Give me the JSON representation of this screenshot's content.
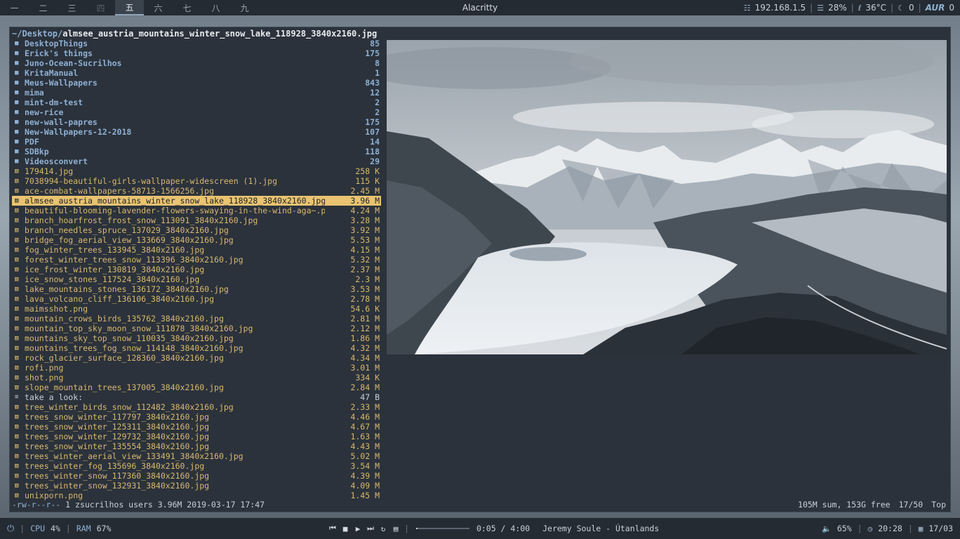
{
  "topbar": {
    "workspaces": [
      {
        "label": "一",
        "state": "normal"
      },
      {
        "label": "二",
        "state": "normal"
      },
      {
        "label": "三",
        "state": "normal"
      },
      {
        "label": "四",
        "state": "empty"
      },
      {
        "label": "五",
        "state": "active"
      },
      {
        "label": "六",
        "state": "normal"
      },
      {
        "label": "七",
        "state": "normal"
      },
      {
        "label": "八",
        "state": "normal"
      },
      {
        "label": "九",
        "state": "normal"
      }
    ],
    "window_title": "Alacritty",
    "ip": "192.168.1.5",
    "disk": "28%",
    "temp": "36°C",
    "moon_count": "0",
    "aur_label": "AUR",
    "aur_count": "0"
  },
  "terminal": {
    "path_dir": "~/Desktop/",
    "path_file": "almsee_austria_mountains_winter_snow_lake_118928_3840x2160.jpg",
    "files": [
      {
        "name": "DesktopThings",
        "size": "85",
        "type": "dir"
      },
      {
        "name": "Erick's things",
        "size": "175",
        "type": "dir"
      },
      {
        "name": "Juno-Ocean-Sucrilhos",
        "size": "8",
        "type": "dir"
      },
      {
        "name": "KritaManual",
        "size": "1",
        "type": "dir"
      },
      {
        "name": "Meus-Wallpapers",
        "size": "843",
        "type": "dir"
      },
      {
        "name": "mima",
        "size": "12",
        "type": "dir"
      },
      {
        "name": "mint-dm-test",
        "size": "2",
        "type": "dir"
      },
      {
        "name": "new-rice",
        "size": "2",
        "type": "dir"
      },
      {
        "name": "new-wall-papres",
        "size": "175",
        "type": "dir"
      },
      {
        "name": "New-Wallpapers-12-2018",
        "size": "107",
        "type": "dir"
      },
      {
        "name": "PDF",
        "size": "14",
        "type": "dir"
      },
      {
        "name": "SDBkp",
        "size": "118",
        "type": "dir"
      },
      {
        "name": "Videosconvert",
        "size": "29",
        "type": "dir"
      },
      {
        "name": "179414.jpg",
        "size": "258 K",
        "type": "img"
      },
      {
        "name": "7038994-beautiful-girls-wallpaper-widescreen (1).jpg",
        "size": "115 K",
        "type": "img"
      },
      {
        "name": "ace-combat-wallpapers-58713-1566256.jpg",
        "size": "2.45 M",
        "type": "img"
      },
      {
        "name": "almsee_austria_mountains_winter_snow_lake_118928_3840x2160.jpg",
        "size": "3.96 M",
        "type": "img",
        "selected": true
      },
      {
        "name": "beautiful-blooming-lavender-flowers-swaying-in-the-wind-aga~.png",
        "size": "4.24 M",
        "type": "img"
      },
      {
        "name": "branch_hoarfrost_frost_snow_113091_3840x2160.jpg",
        "size": "3.28 M",
        "type": "img"
      },
      {
        "name": "branch_needles_spruce_137029_3840x2160.jpg",
        "size": "3.92 M",
        "type": "img"
      },
      {
        "name": "bridge_fog_aerial_view_133669_3840x2160.jpg",
        "size": "5.53 M",
        "type": "img"
      },
      {
        "name": "fog_winter_trees_133945_3840x2160.jpg",
        "size": "4.15 M",
        "type": "img"
      },
      {
        "name": "forest_winter_trees_snow_113396_3840x2160.jpg",
        "size": "5.32 M",
        "type": "img"
      },
      {
        "name": "ice_frost_winter_130819_3840x2160.jpg",
        "size": "2.37 M",
        "type": "img"
      },
      {
        "name": "ice_snow_stones_117524_3840x2160.jpg",
        "size": "2.3 M",
        "type": "img"
      },
      {
        "name": "lake_mountains_stones_136172_3840x2160.jpg",
        "size": "3.53 M",
        "type": "img"
      },
      {
        "name": "lava_volcano_cliff_136106_3840x2160.jpg",
        "size": "2.78 M",
        "type": "img"
      },
      {
        "name": "maimsshot.png",
        "size": "54.6 K",
        "type": "img"
      },
      {
        "name": "mountain_crows_birds_135762_3840x2160.jpg",
        "size": "2.81 M",
        "type": "img"
      },
      {
        "name": "mountain_top_sky_moon_snow_111878_3840x2160.jpg",
        "size": "2.12 M",
        "type": "img"
      },
      {
        "name": "mountains_sky_top_snow_110035_3840x2160.jpg",
        "size": "1.86 M",
        "type": "img"
      },
      {
        "name": "mountains_trees_fog_snow_114148_3840x2160.jpg",
        "size": "4.32 M",
        "type": "img"
      },
      {
        "name": "rock_glacier_surface_128360_3840x2160.jpg",
        "size": "4.34 M",
        "type": "img"
      },
      {
        "name": "rofi.png",
        "size": "3.01 M",
        "type": "img"
      },
      {
        "name": "shot.png",
        "size": "334 K",
        "type": "img"
      },
      {
        "name": "slope_mountain_trees_137005_3840x2160.jpg",
        "size": "2.84 M",
        "type": "img"
      },
      {
        "name": "take a look:",
        "size": "47 B",
        "type": "txt"
      },
      {
        "name": "tree_winter_birds_snow_112482_3840x2160.jpg",
        "size": "2.33 M",
        "type": "img"
      },
      {
        "name": "trees_snow_winter_117797_3840x2160.jpg",
        "size": "4.46 M",
        "type": "img"
      },
      {
        "name": "trees_snow_winter_125311_3840x2160.jpg",
        "size": "4.67 M",
        "type": "img"
      },
      {
        "name": "trees_snow_winter_129732_3840x2160.jpg",
        "size": "1.63 M",
        "type": "img"
      },
      {
        "name": "trees_snow_winter_135554_3840x2160.jpg",
        "size": "4.43 M",
        "type": "img"
      },
      {
        "name": "trees_winter_aerial_view_133491_3840x2160.jpg",
        "size": "5.02 M",
        "type": "img"
      },
      {
        "name": "trees_winter_fog_135696_3840x2160.jpg",
        "size": "3.54 M",
        "type": "img"
      },
      {
        "name": "trees_winter_snow_117360_3840x2160.jpg",
        "size": "4.39 M",
        "type": "img"
      },
      {
        "name": "trees_winter_snow_132931_3840x2160.jpg",
        "size": "4.09 M",
        "type": "img"
      },
      {
        "name": "unixporn.png",
        "size": "1.45 M",
        "type": "img"
      }
    ],
    "status_perm": "-rw-r--r--",
    "status_rest": " 1 zsucrilhos users 3.96M 2019-03-17 17:47",
    "status_sum": "105M sum, 153G free",
    "status_pos": "17/50",
    "status_top": "Top"
  },
  "bottombar": {
    "cpu_label": "CPU",
    "cpu_value": "4%",
    "ram_label": "RAM",
    "ram_value": "67%",
    "time_elapsed": "0:05 / 4:00",
    "track": "Jeremy Soule - Útanlands",
    "progress": 0.021,
    "volume": "65%",
    "clock": "20:28",
    "date": "17/03"
  },
  "colors": {
    "directory": "#8fb0d4",
    "image_file": "#d9b86f",
    "selection": "#e9c370",
    "bar_bg": "#252b33",
    "terminal_bg": "#2b323b"
  },
  "icons": {
    "directory": "folder-icon",
    "image_file": "image-file-icon",
    "text_file": "text-file-icon",
    "network": "network-icon",
    "disk": "disk-icon",
    "temperature": "thermometer-icon",
    "moon": "moon-icon",
    "power": "power-icon",
    "volume": "volume-icon",
    "clock": "clock-icon",
    "calendar": "calendar-icon"
  }
}
